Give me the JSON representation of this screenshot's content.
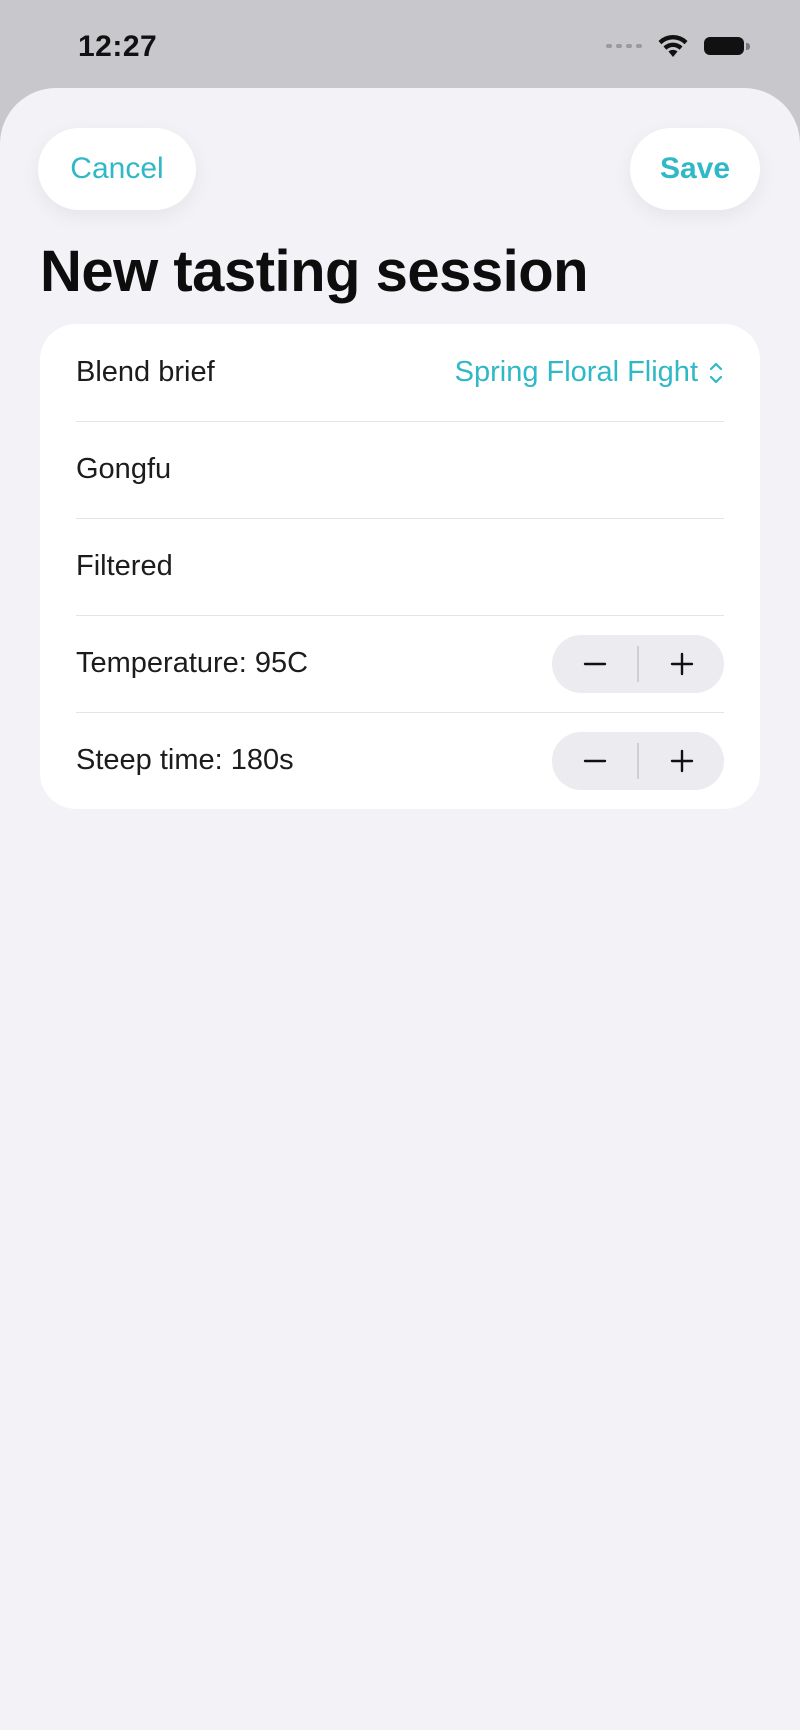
{
  "status_bar": {
    "time": "12:27"
  },
  "toolbar": {
    "cancel_label": "Cancel",
    "save_label": "Save"
  },
  "page": {
    "title": "New tasting session"
  },
  "form": {
    "blend": {
      "label": "Blend brief",
      "value": "Spring Floral Flight"
    },
    "brew_style": {
      "label": "Gongfu"
    },
    "water": {
      "label": "Filtered"
    },
    "temperature": {
      "label": "Temperature: 95C"
    },
    "steep_time": {
      "label": "Steep time: 180s"
    }
  },
  "colors": {
    "accent": "#2fb8c6",
    "sheet_background": "#f2f2f7",
    "card_background": "#ffffff",
    "stepper_background": "#ececf0"
  },
  "icons": {
    "wifi": "wifi-icon",
    "battery": "battery-icon",
    "signal": "cellular-signal-icon",
    "picker": "chevron-up-down-icon",
    "decrement": "minus-icon",
    "increment": "plus-icon"
  }
}
